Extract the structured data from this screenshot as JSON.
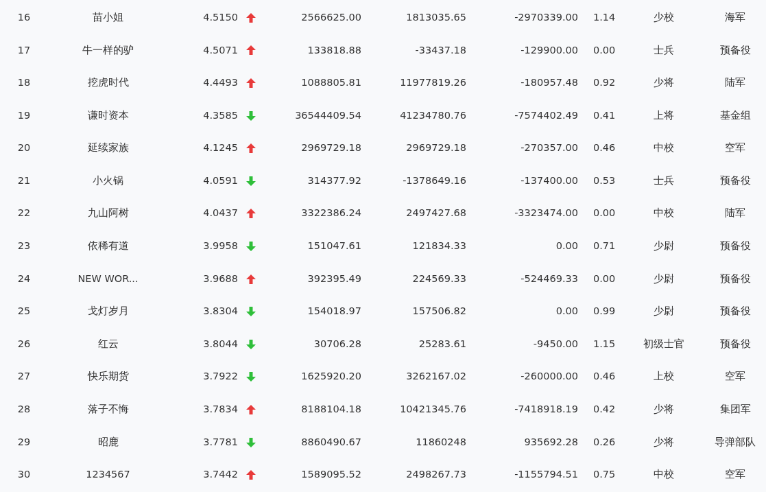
{
  "table": {
    "rows": [
      {
        "rank": "16",
        "name": "苗小姐",
        "score": "4.5150",
        "rising": true,
        "column_4": "2566625.00",
        "column_5": "1813035.65",
        "column_6": "-2970339.00",
        "column_7": "1.14",
        "military_rank": "少校",
        "branch": "海军"
      },
      {
        "rank": "17",
        "name": "牛一样的驴",
        "score": "4.5071",
        "rising": true,
        "column_4": "133818.88",
        "column_5": "-33437.18",
        "column_6": "-129900.00",
        "column_7": "0.00",
        "military_rank": "士兵",
        "branch": "预备役"
      },
      {
        "rank": "18",
        "name": "挖虎时代",
        "score": "4.4493",
        "rising": true,
        "column_4": "1088805.81",
        "column_5": "11977819.26",
        "column_6": "-180957.48",
        "column_7": "0.92",
        "military_rank": "少将",
        "branch": "陆军"
      },
      {
        "rank": "19",
        "name": "谦时资本",
        "score": "4.3585",
        "rising": false,
        "column_4": "36544409.54",
        "column_5": "41234780.76",
        "column_6": "-7574402.49",
        "column_7": "0.41",
        "military_rank": "上将",
        "branch": "基金组"
      },
      {
        "rank": "20",
        "name": "延续家族",
        "score": "4.1245",
        "rising": true,
        "column_4": "2969729.18",
        "column_5": "2969729.18",
        "column_6": "-270357.00",
        "column_7": "0.46",
        "military_rank": "中校",
        "branch": "空军"
      },
      {
        "rank": "21",
        "name": "小火锅",
        "score": "4.0591",
        "rising": false,
        "column_4": "314377.92",
        "column_5": "-1378649.16",
        "column_6": "-137400.00",
        "column_7": "0.53",
        "military_rank": "士兵",
        "branch": "预备役"
      },
      {
        "rank": "22",
        "name": "九山阿树",
        "score": "4.0437",
        "rising": true,
        "column_4": "3322386.24",
        "column_5": "2497427.68",
        "column_6": "-3323474.00",
        "column_7": "0.00",
        "military_rank": "中校",
        "branch": "陆军"
      },
      {
        "rank": "23",
        "name": "依稀有道",
        "score": "3.9958",
        "rising": false,
        "column_4": "151047.61",
        "column_5": "121834.33",
        "column_6": "0.00",
        "column_7": "0.71",
        "military_rank": "少尉",
        "branch": "预备役"
      },
      {
        "rank": "24",
        "name": "NEW WOR...",
        "score": "3.9688",
        "rising": true,
        "column_4": "392395.49",
        "column_5": "224569.33",
        "column_6": "-524469.33",
        "column_7": "0.00",
        "military_rank": "少尉",
        "branch": "预备役"
      },
      {
        "rank": "25",
        "name": "戈灯岁月",
        "score": "3.8304",
        "rising": false,
        "column_4": "154018.97",
        "column_5": "157506.82",
        "column_6": "0.00",
        "column_7": "0.99",
        "military_rank": "少尉",
        "branch": "预备役"
      },
      {
        "rank": "26",
        "name": "红云",
        "score": "3.8044",
        "rising": false,
        "column_4": "30706.28",
        "column_5": "25283.61",
        "column_6": "-9450.00",
        "column_7": "1.15",
        "military_rank": "初级士官",
        "branch": "预备役"
      },
      {
        "rank": "27",
        "name": "快乐期货",
        "score": "3.7922",
        "rising": false,
        "column_4": "1625920.20",
        "column_5": "3262167.02",
        "column_6": "-260000.00",
        "column_7": "0.46",
        "military_rank": "上校",
        "branch": "空军"
      },
      {
        "rank": "28",
        "name": "落子不悔",
        "score": "3.7834",
        "rising": true,
        "column_4": "8188104.18",
        "column_5": "10421345.76",
        "column_6": "-7418918.19",
        "column_7": "0.42",
        "military_rank": "少将",
        "branch": "集团军"
      },
      {
        "rank": "29",
        "name": "昭鹿",
        "score": "3.7781",
        "rising": false,
        "column_4": "8860490.67",
        "column_5": "11860248",
        "column_6": "935692.28",
        "column_7": "0.26",
        "military_rank": "少将",
        "branch": "导弹部队"
      },
      {
        "rank": "30",
        "name": "1234567",
        "score": "3.7442",
        "rising": true,
        "column_4": "1589095.52",
        "column_5": "2498267.73",
        "column_6": "-1155794.51",
        "column_7": "0.75",
        "military_rank": "中校",
        "branch": "空军"
      }
    ]
  }
}
